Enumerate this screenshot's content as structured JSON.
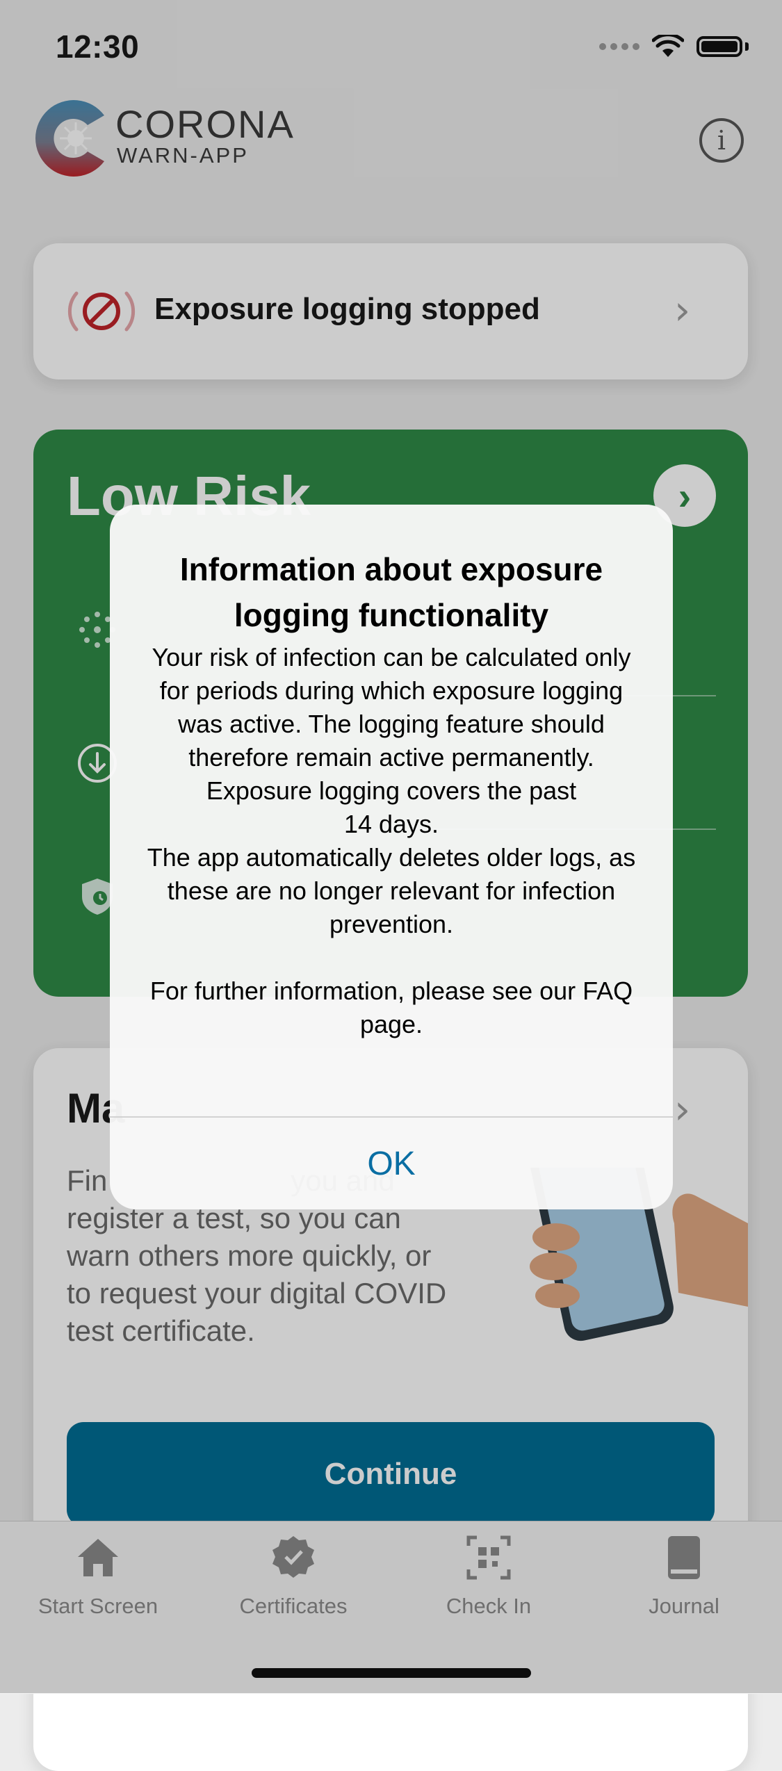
{
  "status_bar": {
    "time": "12:30"
  },
  "header": {
    "logo_title": "CORONA",
    "logo_subtitle": "WARN-APP",
    "info_icon": "info-icon"
  },
  "exposure_card": {
    "label": "Exposure logging stopped",
    "icon": "exposure-stopped-icon"
  },
  "risk_card": {
    "title": "Low Risk",
    "color": "#2f8a46"
  },
  "manage_card": {
    "title": "Ma",
    "text": "Fin                               you and register a test, so you can warn others more quickly, or to request your digital COVID test certificate.",
    "button": "Continue",
    "accent": "#006d94"
  },
  "tabs": [
    {
      "label": "Start Screen",
      "icon": "home-icon"
    },
    {
      "label": "Certificates",
      "icon": "certificate-icon"
    },
    {
      "label": "Check In",
      "icon": "qr-code-icon"
    },
    {
      "label": "Journal",
      "icon": "book-icon"
    }
  ],
  "alert": {
    "title": "Information about exposure logging functionality",
    "paragraphs": [
      "Your risk of infection can be calculated only for periods during which exposure logging was active. The logging feature should therefore remain active permanently.",
      "Exposure logging covers the past 14 days.",
      "The app automatically deletes older logs, as these are no longer relevant for infection prevention.",
      "",
      "For further information, please see our FAQ page."
    ],
    "ok": "OK"
  }
}
